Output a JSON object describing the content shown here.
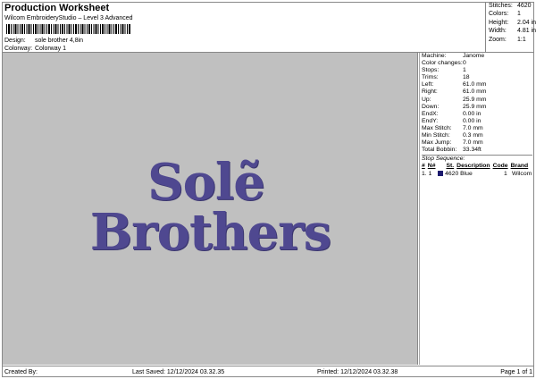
{
  "header": {
    "title": "Production Worksheet",
    "subtitle": "Wilcom EmbroideryStudio – Level 3 Advanced",
    "design_label": "Design:",
    "design_value": "sole brother 4,8in",
    "colorway_label": "Colorway:",
    "colorway_value": "Colorway 1"
  },
  "stats": [
    {
      "k": "Stitches:",
      "v": "4620"
    },
    {
      "k": "Colors:",
      "v": "1"
    },
    {
      "k": "Height:",
      "v": "2.04 in"
    },
    {
      "k": "Width:",
      "v": "4.81 in"
    },
    {
      "k": "Zoom:",
      "v": "1:1"
    }
  ],
  "design": {
    "line1": "Solẽ",
    "line2": "Brothers",
    "thread_color": "#4f4890",
    "background": "#c0c0c0"
  },
  "details": [
    {
      "k": "Machine:",
      "v": "Janome"
    },
    {
      "k": "Color changes:",
      "v": "0"
    },
    {
      "k": "Stops:",
      "v": "1"
    },
    {
      "k": "Trims:",
      "v": "18"
    },
    {
      "k": "Left:",
      "v": "61.0 mm"
    },
    {
      "k": "Right:",
      "v": "61.0 mm"
    },
    {
      "k": "Up:",
      "v": "25.9 mm"
    },
    {
      "k": "Down:",
      "v": "25.9 mm"
    },
    {
      "k": "EndX:",
      "v": "0.00 in"
    },
    {
      "k": "EndY:",
      "v": "0.00 in"
    },
    {
      "k": "Max Stitch:",
      "v": "7.0 mm"
    },
    {
      "k": "Min Stitch:",
      "v": "0.3 mm"
    },
    {
      "k": "Max Jump:",
      "v": "7.0 mm"
    },
    {
      "k": "Total Bobbin:",
      "v": "33.34ft"
    }
  ],
  "stop_sequence": {
    "title": "Stop Sequence:",
    "headers": [
      "#",
      "N#",
      "St.",
      "Description",
      "Code",
      "Brand"
    ],
    "rows": [
      {
        "num": "1.",
        "n": "1",
        "st": "4620",
        "desc": "Blue",
        "code": "1",
        "brand": "Wilcom",
        "color": "#1c1a6e"
      }
    ]
  },
  "footer": {
    "created": "Created By:",
    "saved": "Last Saved: 12/12/2024 03.32.35",
    "printed": "Printed: 12/12/2024 03.32.38",
    "page": "Page 1 of 1"
  }
}
